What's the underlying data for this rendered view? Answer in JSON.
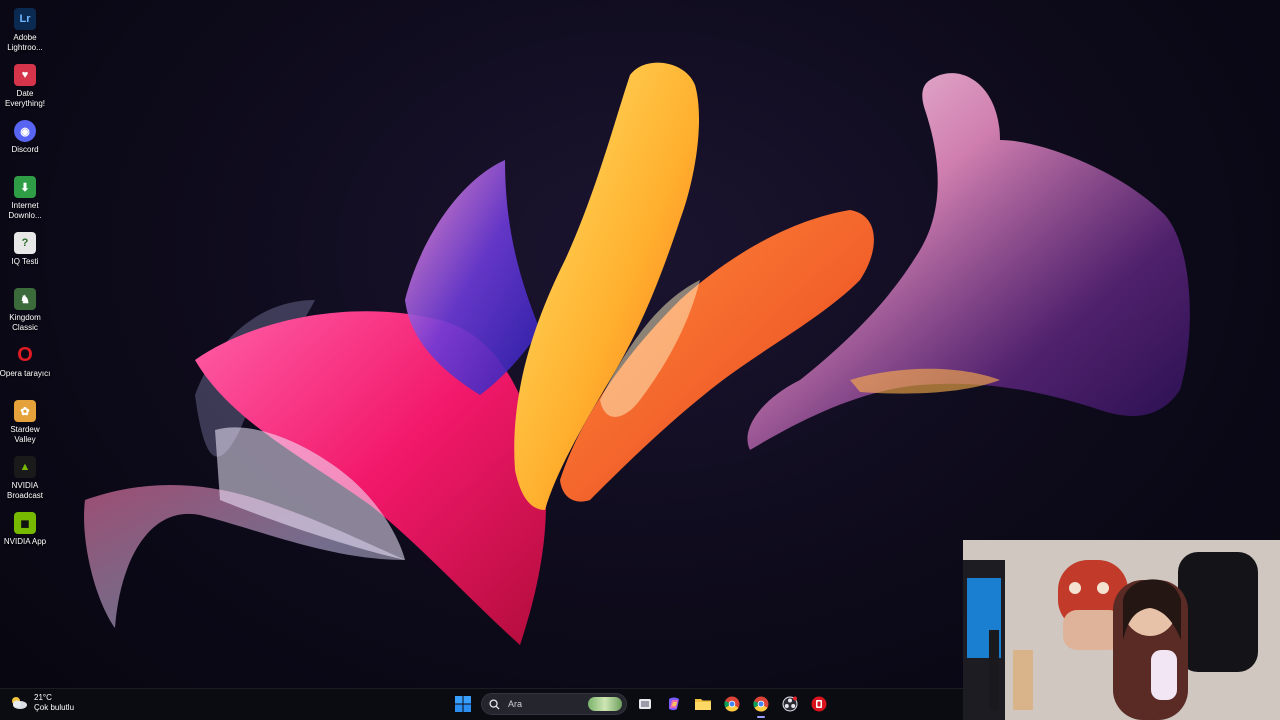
{
  "desktop": {
    "icons": [
      {
        "label": "Adobe Lightroo...",
        "icon": "lightroom-icon",
        "color": "#0a2a52",
        "glyph": "Lr"
      },
      {
        "label": "Date Everything!",
        "icon": "date-everything-icon",
        "color": "#d5344a",
        "glyph": "♥"
      },
      {
        "label": "Discord",
        "icon": "discord-icon",
        "color": "#5865f2",
        "glyph": "◉"
      },
      {
        "label": "Internet Downlo...",
        "icon": "internet-download-manager-icon",
        "color": "#2f9d46",
        "glyph": "⬇"
      },
      {
        "label": "IQ Testi",
        "icon": "iq-test-icon",
        "color": "#e8e8e8",
        "glyph": "?"
      },
      {
        "label": "Kingdom Classic",
        "icon": "kingdom-classic-icon",
        "color": "#3b6b3b",
        "glyph": "♞"
      },
      {
        "label": "Opera tarayıcı",
        "icon": "opera-icon",
        "color": "#d4141e",
        "glyph": "O"
      },
      {
        "label": "Stardew Valley",
        "icon": "stardew-valley-icon",
        "color": "#e5a23a",
        "glyph": "✿"
      },
      {
        "label": "NVIDIA Broadcast",
        "icon": "nvidia-broadcast-icon",
        "color": "#1a1a1a",
        "glyph": "▲"
      },
      {
        "label": "NVIDIA App",
        "icon": "nvidia-app-icon",
        "color": "#76b900",
        "glyph": "◼"
      }
    ]
  },
  "taskbar": {
    "weather": {
      "temp": "21°C",
      "condition": "Çok bulutlu",
      "icon": "cloudy-weather-icon"
    },
    "search": {
      "placeholder": "Ara",
      "icon": "search-icon"
    },
    "pinned": [
      {
        "name": "start-button",
        "icon": "windows-logo-icon"
      },
      {
        "name": "task-view-button",
        "icon": "task-view-icon"
      },
      {
        "name": "copilot-button",
        "icon": "copilot-icon"
      },
      {
        "name": "file-explorer-button",
        "icon": "folder-icon"
      },
      {
        "name": "chrome-button",
        "icon": "chrome-icon"
      },
      {
        "name": "chrome-profile-button",
        "icon": "chrome-icon"
      },
      {
        "name": "obs-button",
        "icon": "obs-icon"
      },
      {
        "name": "red-app-button",
        "icon": "red-app-icon"
      }
    ]
  },
  "colors": {
    "accent": "#9aa0ff",
    "taskbar_bg": "#0b0b12",
    "desktop_bg": "#0d0a1a"
  }
}
